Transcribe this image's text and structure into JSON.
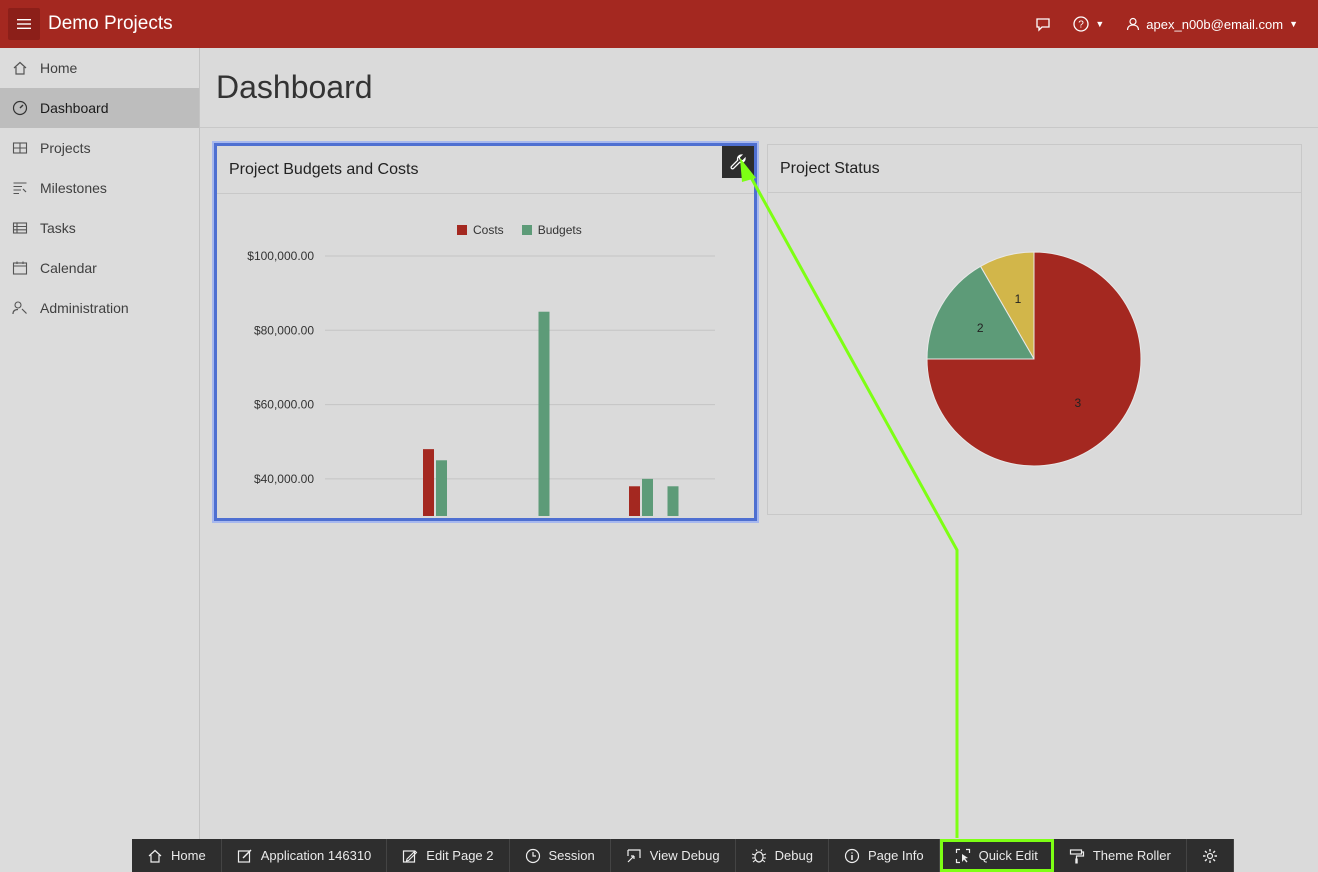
{
  "header": {
    "app_title": "Demo Projects",
    "user": "apex_n00b@email.com",
    "menu_icon": "hamburger-icon",
    "feedback_icon": "chat-bubble-icon",
    "help_icon": "help-icon",
    "user_icon": "user-icon",
    "brand_color": "#a42820"
  },
  "sidebar": {
    "items": [
      {
        "label": "Home",
        "icon": "home-icon"
      },
      {
        "label": "Dashboard",
        "icon": "dashboard-icon"
      },
      {
        "label": "Projects",
        "icon": "projects-icon"
      },
      {
        "label": "Milestones",
        "icon": "milestones-icon"
      },
      {
        "label": "Tasks",
        "icon": "tasks-icon"
      },
      {
        "label": "Calendar",
        "icon": "calendar-icon"
      },
      {
        "label": "Administration",
        "icon": "administration-icon"
      }
    ],
    "active": "Dashboard"
  },
  "main": {
    "page_title": "Dashboard",
    "regions": [
      {
        "title": "Project Budgets and Costs",
        "selected": true
      },
      {
        "title": "Project Status"
      }
    ]
  },
  "chart_data": [
    {
      "type": "bar",
      "title": "Project Budgets and Costs",
      "legend": [
        "Costs",
        "Budgets"
      ],
      "legend_position": "top",
      "yticks": [
        "$100,000.00",
        "$80,000.00",
        "$60,000.00",
        "$40,000.00"
      ],
      "ylim": [
        30000,
        100000
      ],
      "grid": true,
      "groups": [
        {
          "costs": 48000,
          "budgets": 45000
        },
        {
          "costs": null,
          "budgets": 85000
        },
        {
          "costs": 38000,
          "budgets": 40000
        },
        {
          "costs": null,
          "budgets": 38000
        }
      ],
      "colors": {
        "Costs": "#a42820",
        "Budgets": "#5d9b78"
      }
    },
    {
      "type": "pie",
      "title": "Project Status",
      "slices": [
        {
          "label": "1",
          "value": 1,
          "color": "#d2b64a"
        },
        {
          "label": "2",
          "value": 2,
          "color": "#5d9b78"
        },
        {
          "label": "3",
          "value": 9,
          "color": "#a42820"
        }
      ]
    }
  ],
  "devbar": {
    "buttons": [
      {
        "label": "Home",
        "icon": "home-icon"
      },
      {
        "label": "Application 146310",
        "icon": "edit-app-icon"
      },
      {
        "label": "Edit Page 2",
        "icon": "pencil-icon"
      },
      {
        "label": "Session",
        "icon": "clock-icon"
      },
      {
        "label": "View Debug",
        "icon": "view-debug-icon"
      },
      {
        "label": "Debug",
        "icon": "bug-icon"
      },
      {
        "label": "Page Info",
        "icon": "info-icon"
      },
      {
        "label": "Quick Edit",
        "icon": "quick-edit-icon",
        "highlighted": true
      },
      {
        "label": "Theme Roller",
        "icon": "paint-roller-icon"
      },
      {
        "label": "",
        "icon": "gear-icon"
      }
    ]
  },
  "annotation": {
    "arrow_color": "#7dff14"
  }
}
